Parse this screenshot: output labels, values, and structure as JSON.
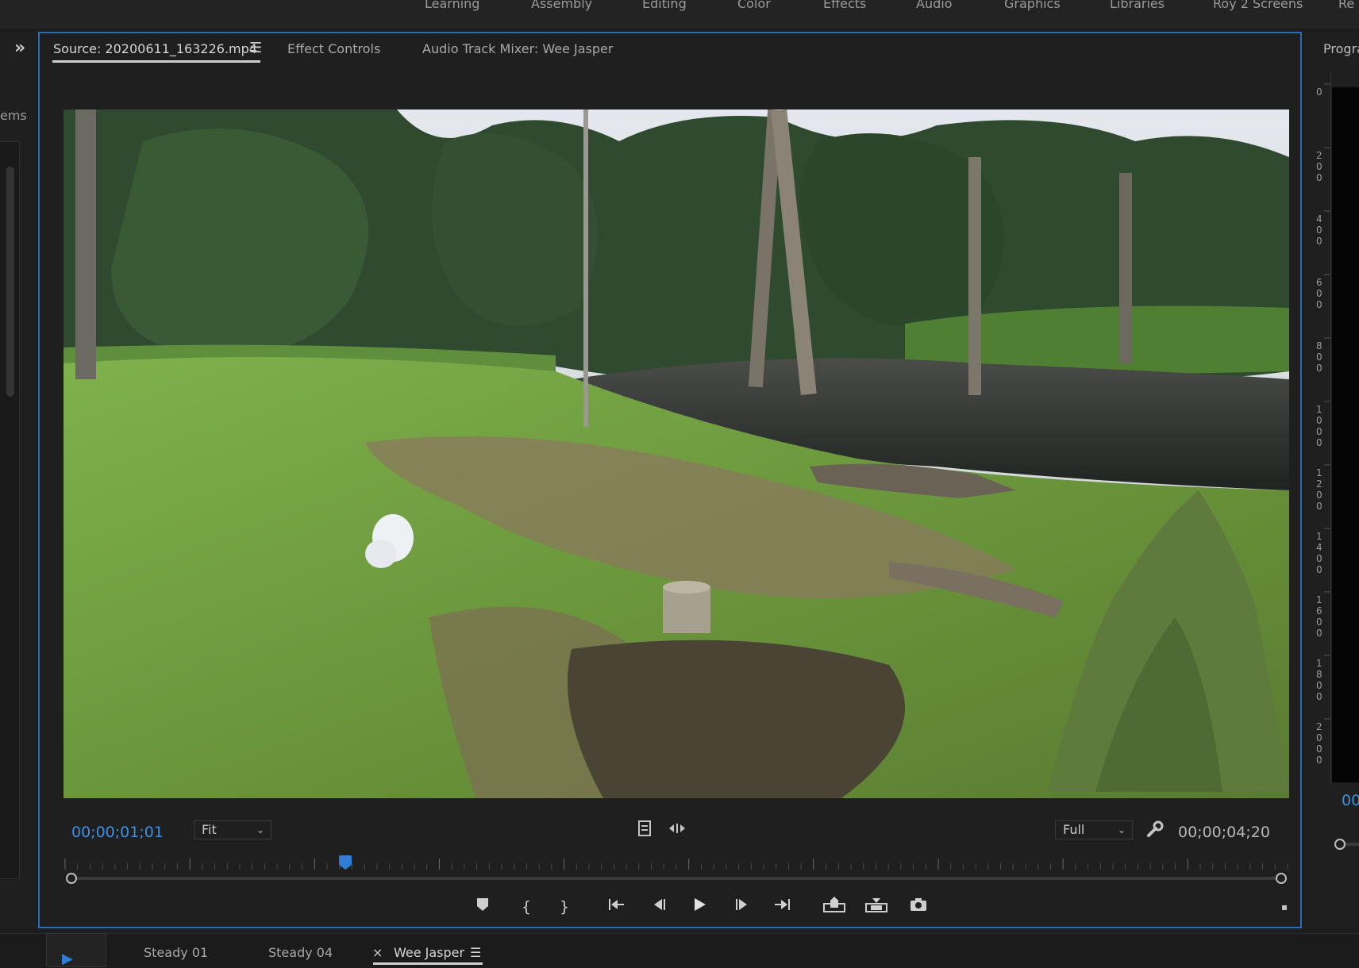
{
  "workspaces": {
    "items": [
      "Learning",
      "Assembly",
      "Editing",
      "Color",
      "Effects",
      "Audio",
      "Graphics",
      "Libraries",
      "Roy 2 Screens",
      "Re"
    ]
  },
  "left_panel": {
    "partial_label": "ems"
  },
  "source_monitor": {
    "tabs": [
      {
        "label": "Source: 20200611_163226.mp4"
      },
      {
        "label": "Effect Controls"
      },
      {
        "label": "Audio Track Mixer: Wee Jasper"
      }
    ],
    "current_timecode": "00;00;01;01",
    "zoom_level": "Fit",
    "resolution": "Full",
    "duration_timecode": "00;00;04;20",
    "playhead_fraction": 0.23
  },
  "program_monitor": {
    "label": "Progra",
    "timecode": "00",
    "ruler_values": [
      "0",
      "200",
      "400",
      "600",
      "800",
      "1000",
      "1200",
      "1400",
      "1600",
      "1800",
      "2000"
    ]
  },
  "timeline_tabs": [
    {
      "label": "Steady 01"
    },
    {
      "label": "Steady 04"
    },
    {
      "label": "Wee Jasper"
    }
  ],
  "colors": {
    "accent_blue": "#2d6bb3",
    "timecode_blue": "#3b8fe0"
  }
}
